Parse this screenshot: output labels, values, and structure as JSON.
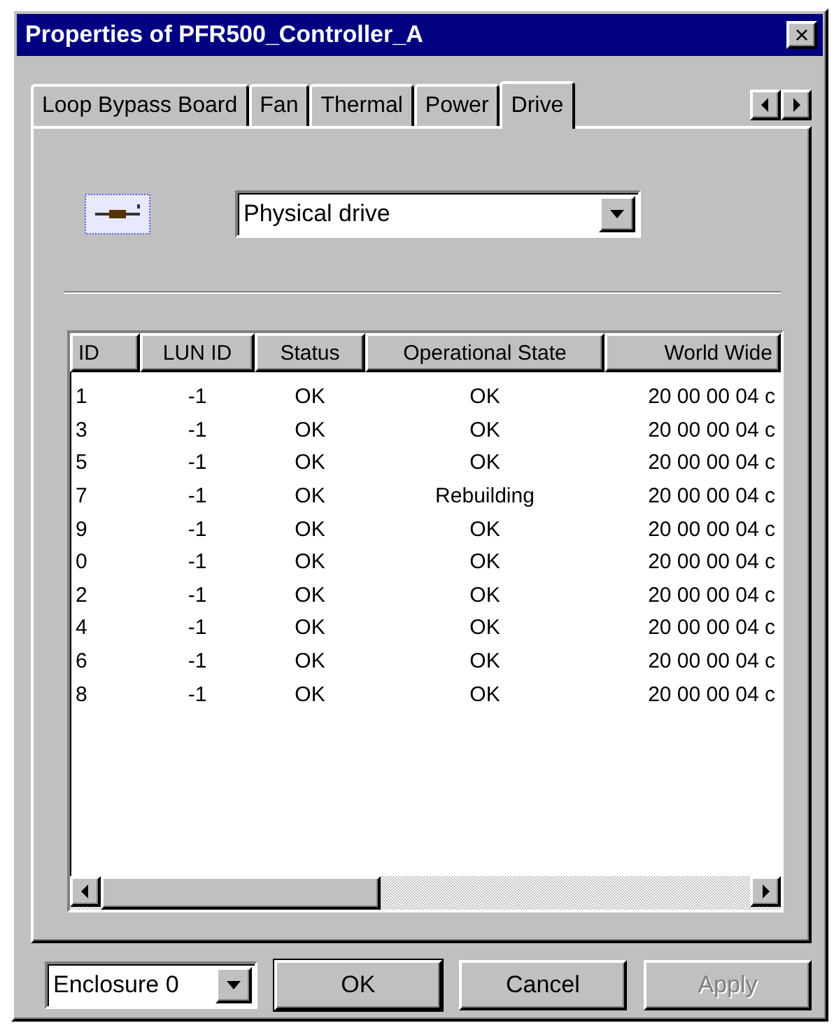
{
  "window": {
    "title": "Properties of PFR500_Controller_A",
    "close": "×"
  },
  "tabs": [
    {
      "label": "Loop Bypass Board",
      "selected": false
    },
    {
      "label": "Fan",
      "selected": false
    },
    {
      "label": "Thermal",
      "selected": false
    },
    {
      "label": "Power",
      "selected": false
    },
    {
      "label": "Drive",
      "selected": true
    }
  ],
  "view_select": {
    "value": "Physical drive"
  },
  "table": {
    "columns": [
      "ID",
      "LUN ID",
      "Status",
      "Operational State",
      "World Wide"
    ],
    "rows": [
      [
        "1",
        "-1",
        "OK",
        "OK",
        "20 00 00 04 c"
      ],
      [
        "3",
        "-1",
        "OK",
        "OK",
        "20 00 00 04 c"
      ],
      [
        "5",
        "-1",
        "OK",
        "OK",
        "20 00 00 04 c"
      ],
      [
        "7",
        "-1",
        "OK",
        "Rebuilding",
        "20 00 00 04 c"
      ],
      [
        "9",
        "-1",
        "OK",
        "OK",
        "20 00 00 04 c"
      ],
      [
        "0",
        "-1",
        "OK",
        "OK",
        "20 00 00 04 c"
      ],
      [
        "2",
        "-1",
        "OK",
        "OK",
        "20 00 00 04 c"
      ],
      [
        "4",
        "-1",
        "OK",
        "OK",
        "20 00 00 04 c"
      ],
      [
        "6",
        "-1",
        "OK",
        "OK",
        "20 00 00 04 c"
      ],
      [
        "8",
        "-1",
        "OK",
        "OK",
        "20 00 00 04 c"
      ]
    ]
  },
  "enclosure_select": {
    "value": "Enclosure 0"
  },
  "buttons": [
    {
      "label": "OK",
      "disabled": false,
      "default": true
    },
    {
      "label": "Cancel",
      "disabled": false,
      "default": false
    },
    {
      "label": "Apply",
      "disabled": true,
      "default": false
    }
  ]
}
